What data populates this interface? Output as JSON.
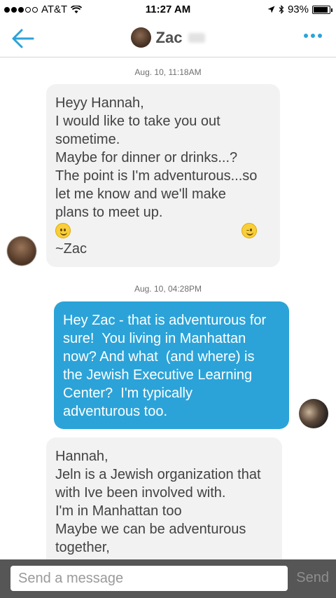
{
  "status_bar": {
    "carrier": "AT&T",
    "time": "11:27 AM",
    "battery_text": "93%",
    "battery_level": 0.93,
    "signal_bars_filled": 3,
    "signal_bars_total": 5
  },
  "nav": {
    "back_icon": "back-arrow-icon",
    "title": "Zac",
    "more_icon": "more-dots-icon",
    "accent_color": "#2ba3d8"
  },
  "messages": [
    {
      "timestamp": "Aug. 10, 11:18AM",
      "direction": "incoming",
      "lines": [
        "Heyy Hannah,",
        "I would like to take you out",
        "sometime.",
        "Maybe for dinner or drinks...?",
        "The point is I'm adventurous...so",
        "let me know and we'll make",
        "plans to meet up."
      ],
      "emojis": [
        "slightly-smiling-face",
        "winking-face"
      ],
      "signature": "~Zac"
    },
    {
      "timestamp": "Aug. 10, 04:28PM",
      "direction": "outgoing",
      "lines": [
        "Hey Zac - that is adventurous for",
        "sure!  You living in Manhattan",
        "now? And what  (and where) is",
        "the Jewish Executive Learning",
        "Center?  I'm typically",
        "adventurous too."
      ]
    },
    {
      "direction": "incoming",
      "lines": [
        "Hannah,",
        "Jeln is a Jewish organization that",
        "with Ive been involved with.",
        "I'm in Manhattan too",
        "Maybe we can be adventurous",
        "together,"
      ]
    }
  ],
  "composer": {
    "placeholder": "Send a message",
    "send_label": "Send"
  }
}
